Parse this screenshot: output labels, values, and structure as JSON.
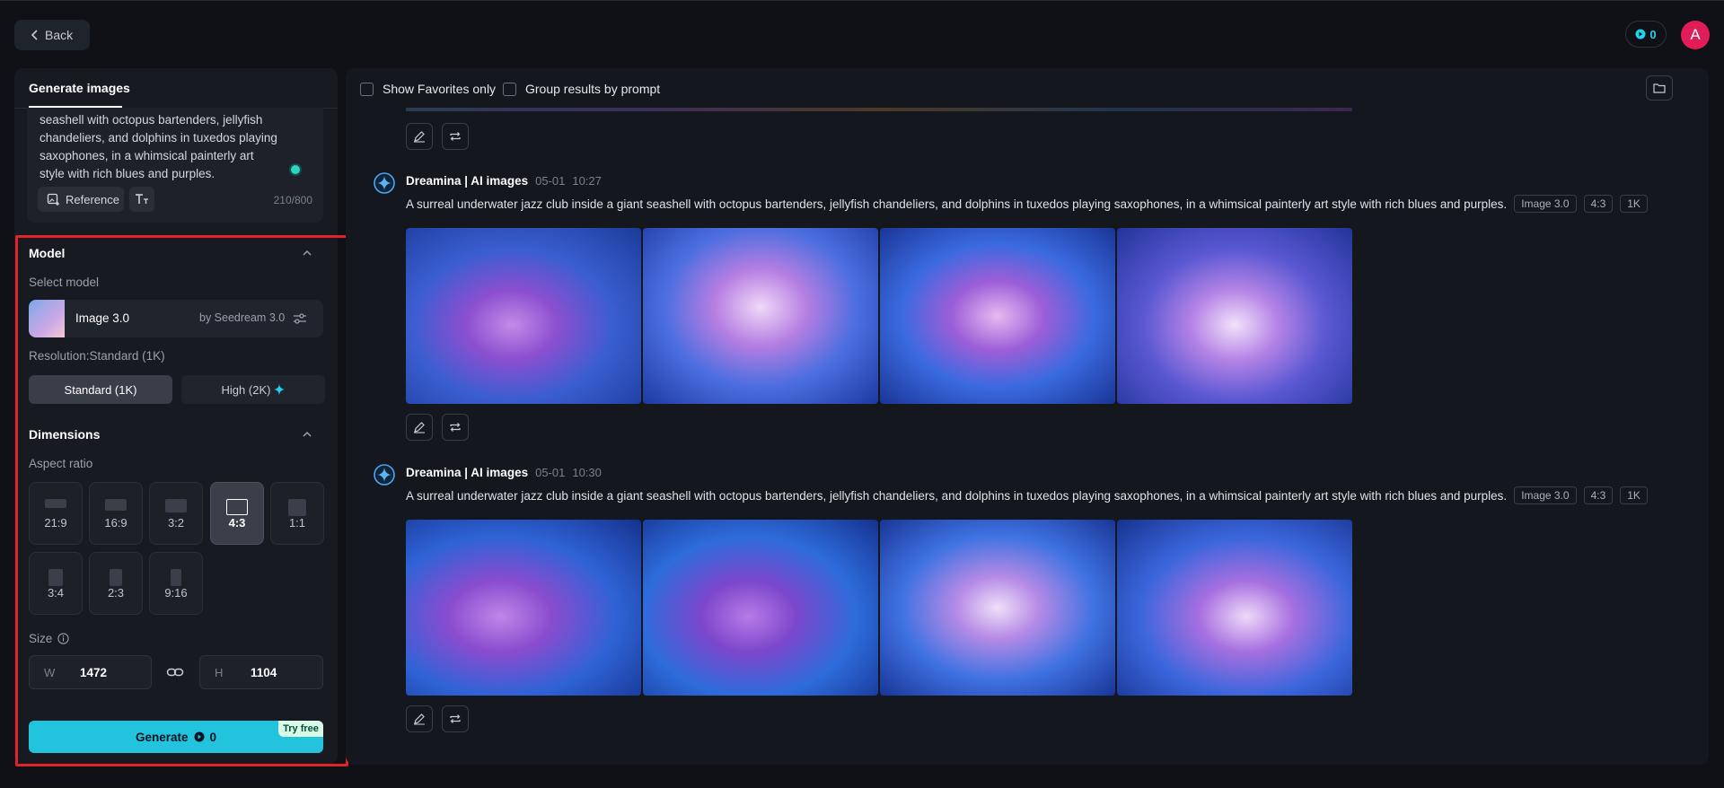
{
  "header": {
    "back_label": "Back",
    "credits": "0",
    "avatar_letter": "A"
  },
  "sidebar": {
    "tab_label": "Generate images",
    "prompt_text": "seashell with octopus bartenders, jellyfish chandeliers, and dolphins in tuxedos playing saxophones, in a whimsical painterly art style with rich blues and purples.",
    "reference_label": "Reference",
    "char_count": "210/800",
    "model_section_title": "Model",
    "select_model_label": "Select model",
    "model_name": "Image 3.0",
    "model_by": "by Seedream 3.0",
    "resolution_label": "Resolution:Standard (1K)",
    "resolution_standard": "Standard (1K)",
    "resolution_high": "High (2K)",
    "dimensions_title": "Dimensions",
    "aspect_label": "Aspect ratio",
    "aspect_ratios": [
      "21:9",
      "16:9",
      "3:2",
      "4:3",
      "1:1",
      "3:4",
      "2:3",
      "9:16"
    ],
    "selected_aspect": "4:3",
    "size_label": "Size",
    "width_key": "W",
    "width_value": "1472",
    "height_key": "H",
    "height_value": "1104",
    "generate_label": "Generate",
    "generate_cost": "0",
    "try_free": "Try free"
  },
  "main": {
    "show_favorites_label": "Show Favorites only",
    "group_results_label": "Group results by prompt",
    "generations": [
      {
        "source": "Dreamina | AI images",
        "date": "05-01",
        "time": "10:27",
        "prompt": "A surreal underwater jazz club inside a giant seashell with octopus bartenders, jellyfish chandeliers, and dolphins in tuxedos playing saxophones, in a whimsical painterly art style with rich blues and purples.",
        "tags": [
          "Image 3.0",
          "4:3",
          "1K"
        ]
      },
      {
        "source": "Dreamina | AI images",
        "date": "05-01",
        "time": "10:30",
        "prompt": "A surreal underwater jazz club inside a giant seashell with octopus bartenders, jellyfish chandeliers, and dolphins in tuxedos playing saxophones, in a whimsical painterly art style with rich blues and purples.",
        "tags": [
          "Image 3.0",
          "4:3",
          "1K"
        ]
      }
    ]
  },
  "icons": {
    "back": "chevron-left-icon",
    "credits": "coin-icon",
    "reference": "image-add-icon",
    "text_style": "text-icon",
    "collapse": "chevron-up-icon",
    "tune": "sliders-icon",
    "sparkle": "sparkle-icon",
    "info": "info-icon",
    "link": "link-icon",
    "folder": "folder-icon",
    "edit": "pencil-icon",
    "regenerate": "repeat-icon",
    "dreamina_logo": "dreamina-logo-icon"
  },
  "colors": {
    "accent": "#22c3dc",
    "highlight_border": "#e1242a",
    "avatar": "#e11d59",
    "background": "#0f1117"
  }
}
